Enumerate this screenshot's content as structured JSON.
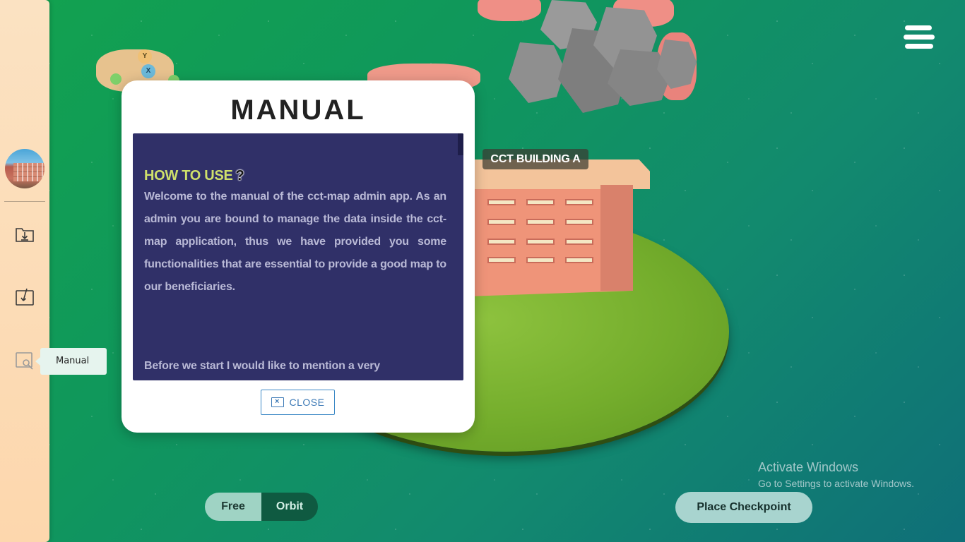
{
  "scene": {
    "building_label": "CCT BUILDING A",
    "gizmo": {
      "y_label": "Y",
      "x_label": "X"
    }
  },
  "sidebar": {
    "avatar_alt": "campus",
    "items": [
      {
        "name": "download-folder-icon"
      },
      {
        "name": "checkin-icon"
      },
      {
        "name": "manual-icon"
      }
    ],
    "tooltip": "Manual"
  },
  "menu": {
    "icon": "hamburger-menu-icon"
  },
  "modal": {
    "title": "MANUAL",
    "heading": "HOW TO USE",
    "heading_icon": "?",
    "paragraph1": "Welcome to the manual of the cct-map admin app. As an admin you are bound to manage the data inside the cct-map application, thus we have provided you some functionalities that are essential to provide a good map to our beneficiaries.",
    "paragraph2": "Before we start I would like to mention a very",
    "close_label": "CLOSE"
  },
  "controls": {
    "mode_free": "Free",
    "mode_orbit": "Orbit",
    "active_mode": "Orbit",
    "place_checkpoint": "Place Checkpoint"
  },
  "watermark": {
    "line1": "Activate Windows",
    "line2": "Go to Settings to activate Windows."
  },
  "colors": {
    "sidebar_bg": "#fbe2c2",
    "content_bg": "#303068",
    "heading_color": "#cfe06b",
    "accent_blue": "#3c79b6"
  }
}
